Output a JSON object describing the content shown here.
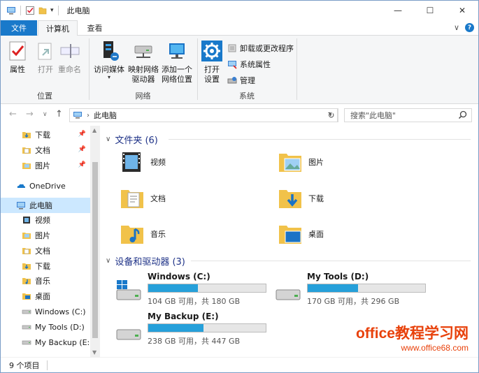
{
  "window": {
    "title": "此电脑"
  },
  "window_controls": {
    "minimize": "—",
    "maximize": "☐",
    "close": "✕"
  },
  "tabs": [
    {
      "label": "文件",
      "active": false
    },
    {
      "label": "计算机",
      "active": true
    },
    {
      "label": "查看",
      "active": false
    }
  ],
  "tabs_right": {
    "collapse": "∨",
    "help": "?"
  },
  "ribbon": {
    "groups": [
      {
        "label": "位置",
        "buttons": [
          "属性",
          "打开",
          "重命名"
        ]
      },
      {
        "label": "网络",
        "buttons": [
          "访问媒体",
          "映射网络\n驱动器",
          "添加一个\n网络位置"
        ]
      },
      {
        "label": "系统",
        "big_button": "打开\n设置",
        "small_buttons": [
          "卸载或更改程序",
          "系统属性",
          "管理"
        ]
      }
    ]
  },
  "address": {
    "crumb": "此电脑",
    "search_placeholder": "搜索\"此电脑\""
  },
  "nav": {
    "items": [
      {
        "label": "下载",
        "icon": "download-folder-icon",
        "pinned": true
      },
      {
        "label": "文档",
        "icon": "documents-folder-icon",
        "pinned": true
      },
      {
        "label": "图片",
        "icon": "pictures-folder-icon",
        "pinned": true
      },
      {
        "label": "OneDrive",
        "icon": "onedrive-icon",
        "pinned": false
      },
      {
        "label": "此电脑",
        "icon": "pc-icon",
        "pinned": false,
        "selected": true
      },
      {
        "label": "视频",
        "icon": "videos-folder-icon",
        "pinned": false
      },
      {
        "label": "图片",
        "icon": "pictures-folder-icon",
        "pinned": false
      },
      {
        "label": "文档",
        "icon": "documents-folder-icon",
        "pinned": false
      },
      {
        "label": "下载",
        "icon": "download-folder-icon",
        "pinned": false
      },
      {
        "label": "音乐",
        "icon": "music-folder-icon",
        "pinned": false
      },
      {
        "label": "桌面",
        "icon": "desktop-folder-icon",
        "pinned": false
      },
      {
        "label": "Windows (C:)",
        "icon": "drive-icon",
        "pinned": false
      },
      {
        "label": "My Tools (D:)",
        "icon": "drive-icon",
        "pinned": false
      },
      {
        "label": "My Backup (E:",
        "icon": "drive-icon",
        "pinned": false
      }
    ]
  },
  "content": {
    "folders_header": "文件夹 (6)",
    "folders": [
      {
        "label": "视频",
        "icon": "videos-folder-icon"
      },
      {
        "label": "图片",
        "icon": "pictures-folder-icon"
      },
      {
        "label": "文档",
        "icon": "documents-folder-icon"
      },
      {
        "label": "下载",
        "icon": "download-folder-icon"
      },
      {
        "label": "音乐",
        "icon": "music-folder-icon"
      },
      {
        "label": "桌面",
        "icon": "desktop-folder-icon"
      }
    ],
    "drives_header": "设备和驱动器 (3)",
    "drives": [
      {
        "name": "Windows (C:)",
        "free": "104 GB 可用，共 180 GB",
        "used_fraction": 0.42
      },
      {
        "name": "My Tools (D:)",
        "free": "170 GB 可用，共 296 GB",
        "used_fraction": 0.43
      },
      {
        "name": "My Backup (E:)",
        "free": "238 GB 可用，共 447 GB",
        "used_fraction": 0.47
      }
    ]
  },
  "status": {
    "count": "9 个项目"
  },
  "watermark": {
    "logo": "office教程学习网",
    "url": "www.office68.com"
  },
  "colors": {
    "accent": "#1979ca",
    "selected": "#cce8ff",
    "bar_fill": "#26a0da",
    "section": "#1e3287",
    "watermark": "#e8410b"
  }
}
